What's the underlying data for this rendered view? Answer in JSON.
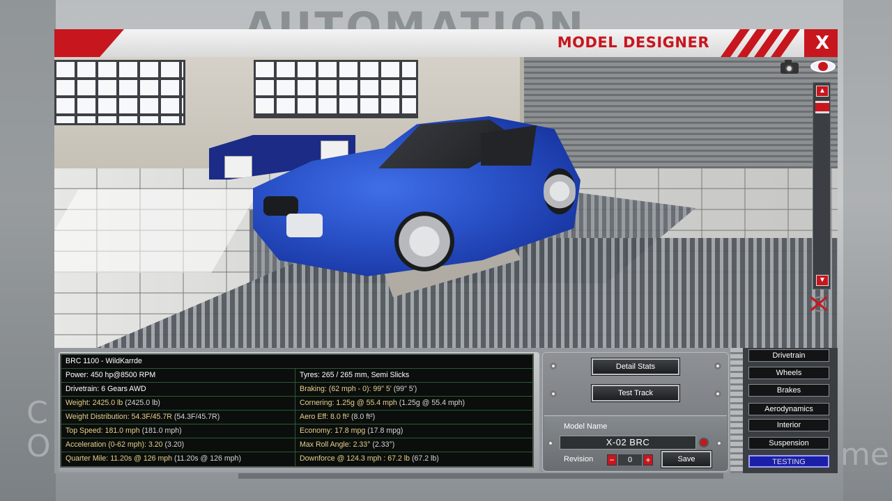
{
  "game": {
    "background_logo": "AUTOMATION",
    "background_text_left": "C\nO",
    "background_text_right": "me"
  },
  "window": {
    "title": "MODEL DESIGNER",
    "close_label": "X"
  },
  "viewport": {
    "camera_icon": "camera-icon",
    "eye_icon": "eye-icon",
    "scroll_up_icon": "chevron-up-icon",
    "scroll_down_icon": "chevron-down-icon",
    "reset_icon": "reset-view-icon"
  },
  "stats": {
    "header": "BRC 1100 - WildKarrde",
    "rows": [
      {
        "left": {
          "label": "Power:",
          "value": "450 hp@8500 RPM",
          "paren": "",
          "gold": false
        },
        "right": {
          "label": "Tyres:",
          "value": "265 / 265 mm, Semi Slicks",
          "paren": "",
          "gold": false
        }
      },
      {
        "left": {
          "label": "Drivetrain:",
          "value": "6 Gears AWD",
          "paren": "",
          "gold": false
        },
        "right": {
          "label": "Braking: (62 mph - 0):",
          "value": "99\" 5'",
          "paren": "(99\" 5')",
          "gold": true
        }
      },
      {
        "left": {
          "label": "Weight:",
          "value": "2425.0 lb",
          "paren": "(2425.0 lb)",
          "gold": true
        },
        "right": {
          "label": "Cornering:",
          "value": "1.25g @ 55.4 mph",
          "paren": "(1.25g @ 55.4 mph)",
          "gold": true
        }
      },
      {
        "left": {
          "label": "Weight Distribution:",
          "value": "54.3F/45.7R",
          "paren": "(54.3F/45.7R)",
          "gold": true
        },
        "right": {
          "label": "Aero Eff:",
          "value": "8.0 ft²",
          "paren": "(8.0 ft²)",
          "gold": true
        }
      },
      {
        "left": {
          "label": "Top Speed:",
          "value": "181.0 mph",
          "paren": "(181.0 mph)",
          "gold": true
        },
        "right": {
          "label": "Economy:",
          "value": "17.8 mpg",
          "paren": "(17.8 mpg)",
          "gold": true
        }
      },
      {
        "left": {
          "label": "Acceleration (0-62 mph):",
          "value": "3.20",
          "paren": "(3.20)",
          "gold": true
        },
        "right": {
          "label": "Max Roll Angle:",
          "value": "2.33°",
          "paren": "(2.33°)",
          "gold": true
        }
      },
      {
        "left": {
          "label": "Quarter Mile:",
          "value": "11.20s @ 126 mph",
          "paren": "(11.20s @ 126 mph)",
          "gold": true
        },
        "right": {
          "label": "Downforce @ 124.3 mph :",
          "value": "67.2 lb",
          "paren": "(67.2 lb)",
          "gold": true
        }
      }
    ]
  },
  "actions": {
    "detail_stats": "Detail Stats",
    "test_track": "Test Track"
  },
  "model": {
    "name_label": "Model Name",
    "name_value": "X-02 BRC",
    "revision_label": "Revision",
    "revision_minus": "−",
    "revision_value": "0",
    "revision_plus": "+",
    "save_label": "Save"
  },
  "nav": {
    "items": [
      {
        "label": "Drivetrain",
        "active": false
      },
      {
        "label": "Wheels",
        "active": false
      },
      {
        "label": "Brakes",
        "active": false
      },
      {
        "label": "Aerodynamics",
        "active": false
      },
      {
        "label": "Interior",
        "active": false
      },
      {
        "label": "Suspension",
        "active": false
      },
      {
        "label": "TESTING",
        "active": true
      }
    ]
  },
  "colors": {
    "accent_red": "#c8161e",
    "stat_gold": "#e6d08a",
    "active_tab": "#1b1fa8",
    "car_blue": "#2a52c8"
  }
}
